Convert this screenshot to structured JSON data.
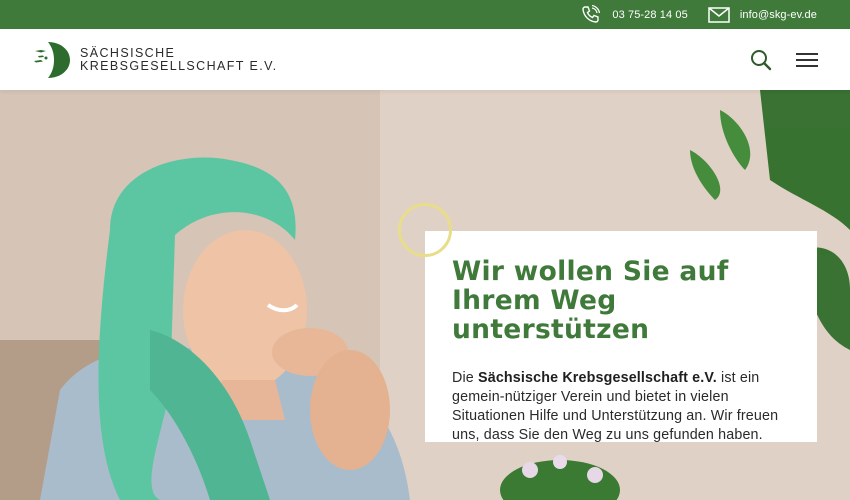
{
  "topbar": {
    "phone": "03 75-28 14 05",
    "email": "info@skg-ev.de",
    "phone_icon": "phone-icon",
    "email_icon": "mail-icon"
  },
  "header": {
    "logo_line1": "SÄCHSISCHE",
    "logo_line2": "KREBSGESELLSCHAFT E.V.",
    "search_icon": "search-icon",
    "menu_icon": "hamburger-menu-icon"
  },
  "hero": {
    "title": "Wir wollen Sie auf Ihrem Weg unterstützen",
    "text_prefix": "Die ",
    "text_strong": "Sächsische Krebsgesellschaft e.V.",
    "text_rest": " ist ein gemein-nütziger Verein und bietet in vielen Situationen Hilfe und Unterstützung an. Wir freuen uns, dass Sie den Weg zu uns gefunden haben."
  },
  "colors": {
    "brand_green": "#3f7a3a",
    "accent_ring": "#e8de8a"
  }
}
